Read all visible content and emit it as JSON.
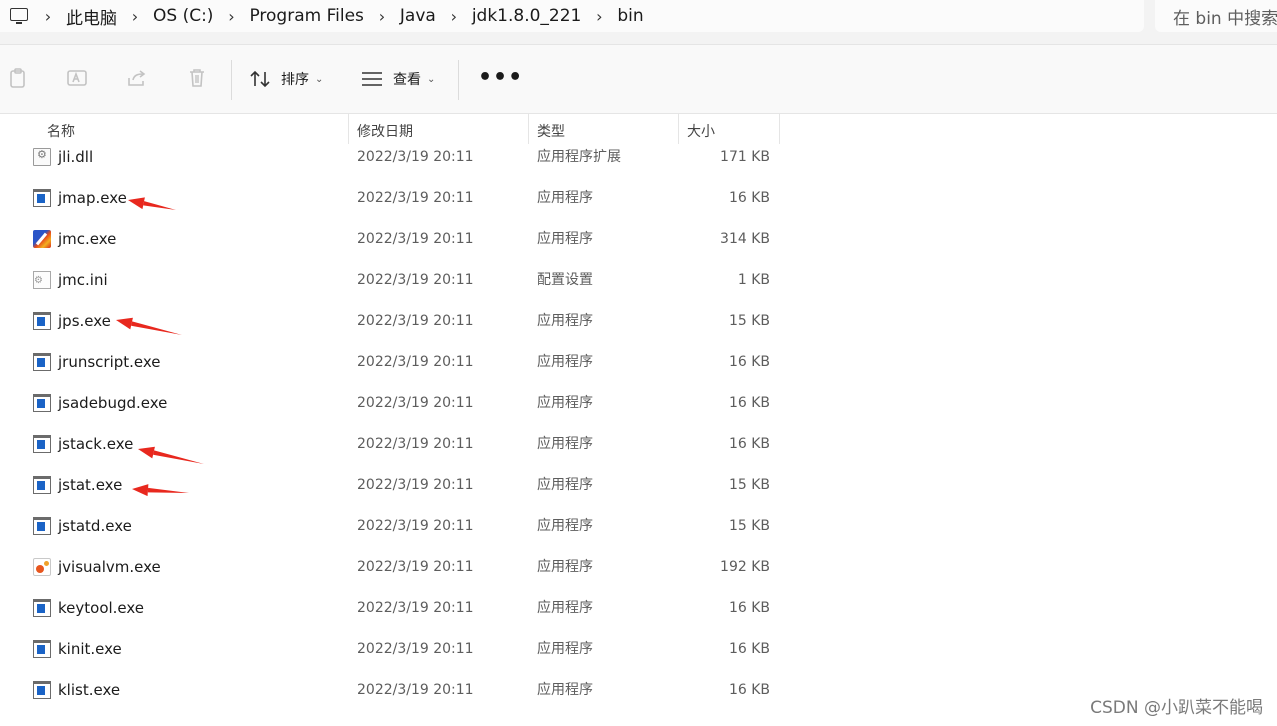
{
  "breadcrumbs": [
    "此电脑",
    "OS (C:)",
    "Program Files",
    "Java",
    "jdk1.8.0_221",
    "bin"
  ],
  "search": {
    "placeholder": "在 bin 中搜索"
  },
  "toolbar": {
    "sort_label": "排序",
    "view_label": "查看",
    "more_label": "•••"
  },
  "columns": {
    "name": "名称",
    "date": "修改日期",
    "type": "类型",
    "size": "大小"
  },
  "files": [
    {
      "name": "jli.dll",
      "date": "2022/3/19 20:11",
      "type": "应用程序扩展",
      "size": "171 KB",
      "icon": "dll-icon"
    },
    {
      "name": "jmap.exe",
      "date": "2022/3/19 20:11",
      "type": "应用程序",
      "size": "16 KB",
      "icon": "exe-icon"
    },
    {
      "name": "jmc.exe",
      "date": "2022/3/19 20:11",
      "type": "应用程序",
      "size": "314 KB",
      "icon": "jmc-icon"
    },
    {
      "name": "jmc.ini",
      "date": "2022/3/19 20:11",
      "type": "配置设置",
      "size": "1 KB",
      "icon": "ini-icon"
    },
    {
      "name": "jps.exe",
      "date": "2022/3/19 20:11",
      "type": "应用程序",
      "size": "15 KB",
      "icon": "exe-icon"
    },
    {
      "name": "jrunscript.exe",
      "date": "2022/3/19 20:11",
      "type": "应用程序",
      "size": "16 KB",
      "icon": "exe-icon"
    },
    {
      "name": "jsadebugd.exe",
      "date": "2022/3/19 20:11",
      "type": "应用程序",
      "size": "16 KB",
      "icon": "exe-icon"
    },
    {
      "name": "jstack.exe",
      "date": "2022/3/19 20:11",
      "type": "应用程序",
      "size": "16 KB",
      "icon": "exe-icon"
    },
    {
      "name": "jstat.exe",
      "date": "2022/3/19 20:11",
      "type": "应用程序",
      "size": "15 KB",
      "icon": "exe-icon"
    },
    {
      "name": "jstatd.exe",
      "date": "2022/3/19 20:11",
      "type": "应用程序",
      "size": "15 KB",
      "icon": "exe-icon"
    },
    {
      "name": "jvisualvm.exe",
      "date": "2022/3/19 20:11",
      "type": "应用程序",
      "size": "192 KB",
      "icon": "jvisualvm-icon"
    },
    {
      "name": "keytool.exe",
      "date": "2022/3/19 20:11",
      "type": "应用程序",
      "size": "16 KB",
      "icon": "exe-icon"
    },
    {
      "name": "kinit.exe",
      "date": "2022/3/19 20:11",
      "type": "应用程序",
      "size": "16 KB",
      "icon": "exe-icon"
    },
    {
      "name": "klist.exe",
      "date": "2022/3/19 20:11",
      "type": "应用程序",
      "size": "16 KB",
      "icon": "exe-icon"
    }
  ],
  "annotation_color": "#e8281e",
  "watermark": "CSDN @小趴菜不能喝"
}
